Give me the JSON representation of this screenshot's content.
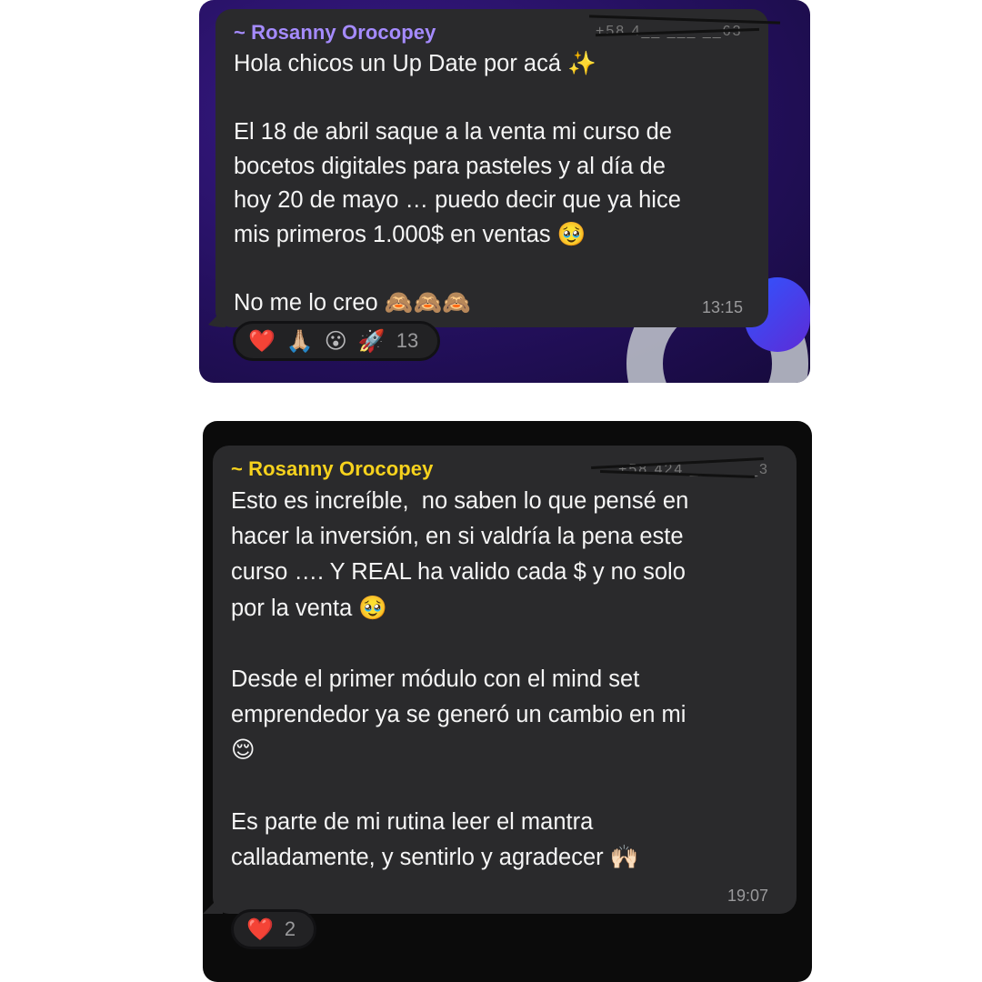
{
  "messages": [
    {
      "sender": "~ Rosanny Orocopey",
      "phone": "+58 4__ ___ __63",
      "text": "Hola chicos un Up Date por acá ✨\n\nEl 18 de abril saque a la venta mi curso de\nbocetos digitales para pasteles y al día de\nhoy 20 de mayo … puedo decir que ya hice\nmis primeros 1.000$ en ventas 🥹\n\nNo me lo creo 🙈🙈🙈",
      "time": "13:15",
      "reactions": [
        "❤️",
        "🙏🏼",
        "😮",
        "🚀"
      ],
      "reaction_count": "13"
    },
    {
      "sender": "~ Rosanny Orocopey",
      "phone": "+58 424 _______3",
      "text": "Esto es increíble,  no saben lo que pensé en\nhacer la inversión, en si valdría la pena este\ncurso …. Y REAL ha valido cada $ y no solo\npor la venta 🥹\n\nDesde el primer módulo con el mind set\nemprendedor ya se generó un cambio en mi\n😌\n\nEs parte de mi rutina leer el mantra\ncalladamente, y sentirlo y agradecer 🙌🏻",
      "time": "19:07",
      "reactions": [
        "❤️"
      ],
      "reaction_count": "2"
    }
  ],
  "colors": {
    "sender1": "#a58bff",
    "sender2": "#f6d21d",
    "bubble": "#2a2a2c",
    "bg1": "#24105e",
    "bg2": "#0b0b0b"
  }
}
